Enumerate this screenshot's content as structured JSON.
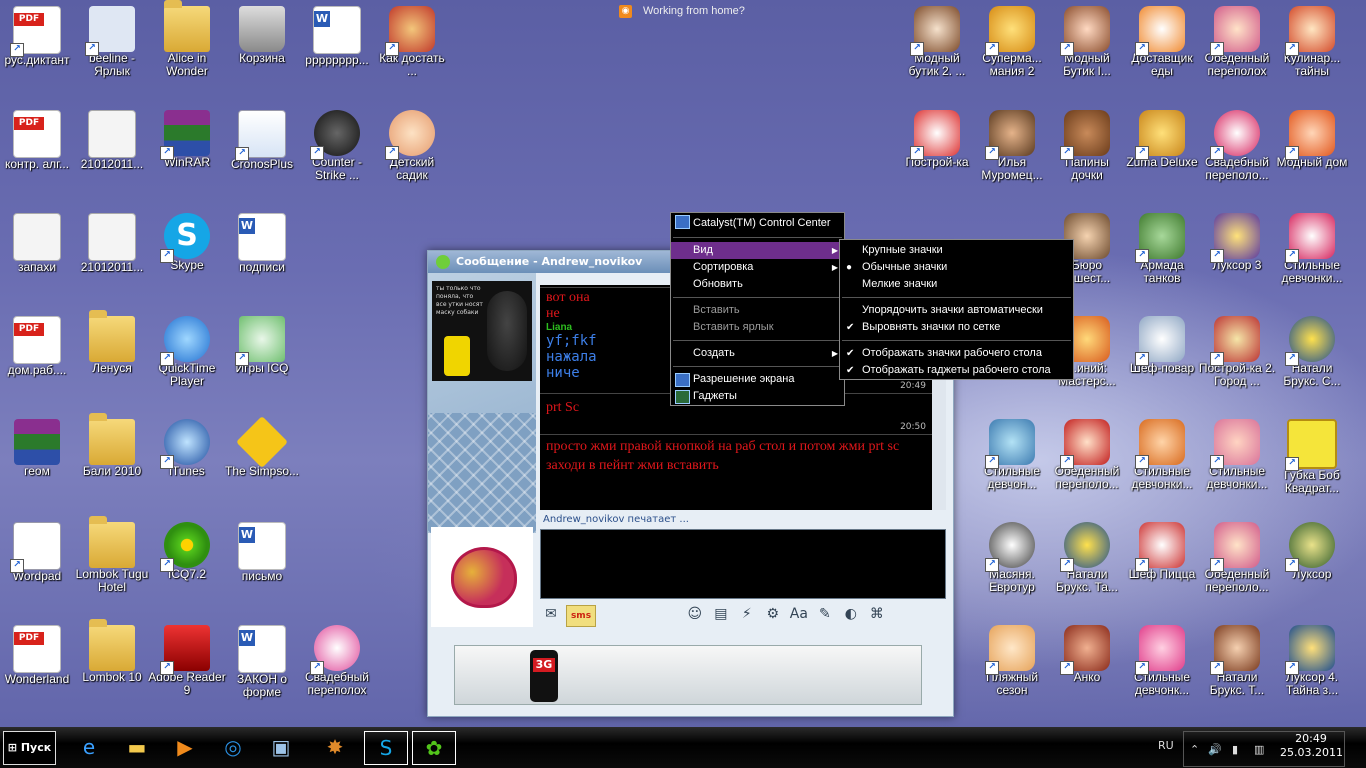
{
  "top_feed": {
    "text": "Working from home?"
  },
  "desktop_icons": [
    {
      "label": "рус.диктант",
      "icon": "pdf-icon"
    },
    {
      "label": "beeline - Ярлык",
      "icon": "beeline-icon"
    },
    {
      "label": "Alice in Wonder",
      "icon": "folder-icon"
    },
    {
      "label": "Корзина",
      "icon": "recycle-bin-icon"
    },
    {
      "label": "рррррррр...",
      "icon": "word-doc-icon"
    },
    {
      "label": "Как достать ...",
      "icon": "game-icon"
    },
    {
      "label": "контр. алг...",
      "icon": "pdf-icon"
    },
    {
      "label": "21012011...",
      "icon": "text-doc-icon"
    },
    {
      "label": "WinRAR",
      "icon": "winrar-icon"
    },
    {
      "label": "CronosPlus",
      "icon": "cronos-icon"
    },
    {
      "label": "Counter - Strike ...",
      "icon": "counter-strike-icon"
    },
    {
      "label": "Детский садик",
      "icon": "game-icon"
    },
    {
      "label": "запахи",
      "icon": "text-doc-icon"
    },
    {
      "label": "21012011...",
      "icon": "text-doc-icon"
    },
    {
      "label": "Skype",
      "icon": "skype-icon"
    },
    {
      "label": "подписи",
      "icon": "word-doc-icon"
    },
    {
      "label": "дом.раб....",
      "icon": "pdf-icon"
    },
    {
      "label": "Ленуся",
      "icon": "folder-icon"
    },
    {
      "label": "QuickTime Player",
      "icon": "quicktime-icon"
    },
    {
      "label": "Игры ICQ",
      "icon": "gamepad-icon"
    },
    {
      "label": "геом",
      "icon": "winrar-icon"
    },
    {
      "label": "Бали 2010",
      "icon": "folder-icon"
    },
    {
      "label": "iTunes",
      "icon": "itunes-icon"
    },
    {
      "label": "The Simpso...",
      "icon": "game-icon"
    },
    {
      "label": "Wordpad",
      "icon": "wordpad-icon"
    },
    {
      "label": "Lombok Tugu Hotel",
      "icon": "folder-icon"
    },
    {
      "label": "ICQ7.2",
      "icon": "icq-icon"
    },
    {
      "label": "письмо",
      "icon": "word-doc-icon"
    },
    {
      "label": "Wonderland",
      "icon": "pdf-icon"
    },
    {
      "label": "Lombok 10",
      "icon": "folder-icon"
    },
    {
      "label": "Adobe Reader 9",
      "icon": "adobe-reader-icon"
    },
    {
      "label": "ЗАКОН о форме",
      "icon": "word-doc-icon"
    },
    {
      "label": "Свадебный переполох",
      "icon": "game-icon"
    },
    {
      "label": "Модный бутик 2. ...",
      "icon": "game-icon"
    },
    {
      "label": "Суперма... мания 2",
      "icon": "game-icon"
    },
    {
      "label": "Модный Бутик I...",
      "icon": "game-icon"
    },
    {
      "label": "Доставщик еды",
      "icon": "game-icon"
    },
    {
      "label": "Обеденный переполох",
      "icon": "game-icon"
    },
    {
      "label": "Кулинар... тайны",
      "icon": "game-icon"
    },
    {
      "label": "Построй-ка",
      "icon": "game-icon"
    },
    {
      "label": "Илья Муромец...",
      "icon": "game-icon"
    },
    {
      "label": "Папины дочки",
      "icon": "game-icon"
    },
    {
      "label": "Zuma Deluxe",
      "icon": "game-icon"
    },
    {
      "label": "Свадебный переполо...",
      "icon": "game-icon"
    },
    {
      "label": "Модный дом",
      "icon": "game-icon"
    },
    {
      "label": "Бюро ...шест...",
      "icon": "game-icon"
    },
    {
      "label": "Армада танков",
      "icon": "game-icon"
    },
    {
      "label": "Луксор 3",
      "icon": "game-icon"
    },
    {
      "label": "Стильные девчонки...",
      "icon": "game-icon"
    },
    {
      "label": "...иний: Мастерс...",
      "icon": "game-icon"
    },
    {
      "label": "Шеф-повар",
      "icon": "game-icon"
    },
    {
      "label": "Построй-ка 2. Город ...",
      "icon": "game-icon"
    },
    {
      "label": "Натали Брукс. С...",
      "icon": "game-icon"
    },
    {
      "label": "Стильные девчон...",
      "icon": "game-icon"
    },
    {
      "label": "Обеденный переполо...",
      "icon": "game-icon"
    },
    {
      "label": "Стильные девчонки...",
      "icon": "game-icon"
    },
    {
      "label": "Стильные девчонки...",
      "icon": "game-icon"
    },
    {
      "label": "Губка Боб Квадрат...",
      "icon": "game-icon"
    },
    {
      "label": "Масяня. Евротур",
      "icon": "game-icon"
    },
    {
      "label": "Натали Брукс. Та...",
      "icon": "game-icon"
    },
    {
      "label": "Шеф Пицца",
      "icon": "game-icon"
    },
    {
      "label": "Обеденный переполо...",
      "icon": "game-icon"
    },
    {
      "label": "Луксор",
      "icon": "game-icon"
    },
    {
      "label": "Пляжный сезон",
      "icon": "game-icon"
    },
    {
      "label": "Анко",
      "icon": "game-icon"
    },
    {
      "label": "Стильные девчонк...",
      "icon": "game-icon"
    },
    {
      "label": "Натали Брукс. Т...",
      "icon": "game-icon"
    },
    {
      "label": "Луксор 4. Тайна з...",
      "icon": "game-icon"
    }
  ],
  "messenger": {
    "title": "Сообщение - Andrew_novikov",
    "avatar_caption": "ты только что поняла, что все утки носят маску собаки",
    "messages": [
      {
        "text": "вот она",
        "color": "red"
      },
      {
        "text": "не",
        "color": "red"
      },
      {
        "text": "Liana",
        "color": "green"
      },
      {
        "text": "yf;fkf",
        "color": "blue"
      },
      {
        "text": "нажала",
        "color": "blue"
      },
      {
        "text": "ниче",
        "color": "blue"
      }
    ],
    "time1": "20:49",
    "msg2": "prt Sc",
    "time2": "20:50",
    "msg3": "просто жми правой кнопкой на раб стол и потом жми prt sc заходи в пейнт жми вставить",
    "typing": "Andrew_novikov печатает ...",
    "sms_label": "sms",
    "banner_phone": "3G"
  },
  "context_menu": {
    "header": "Catalyst(TM) Control Center",
    "view": "Вид",
    "sort": "Сортировка",
    "refresh": "Обновить",
    "paste": "Вставить",
    "paste_shortcut": "Вставить ярлык",
    "create": "Создать",
    "resolution": "Разрешение экрана",
    "gadgets": "Гаджеты"
  },
  "view_submenu": {
    "large": "Крупные значки",
    "medium": "Обычные значки",
    "small": "Мелкие значки",
    "auto_arrange": "Упорядочить значки автоматически",
    "align_grid": "Выровнять значки по сетке",
    "show_icons": "Отображать значки рабочего стола",
    "show_gadgets": "Отображать гаджеты  рабочего стола"
  },
  "taskbar": {
    "start": "Пуск",
    "lang": "RU",
    "time": "20:49",
    "date": "25.03.2011"
  },
  "colors": {
    "menu_highlight": "#6e2e8c",
    "menu_bg": "#000000",
    "desktop": "#6a6db2"
  }
}
